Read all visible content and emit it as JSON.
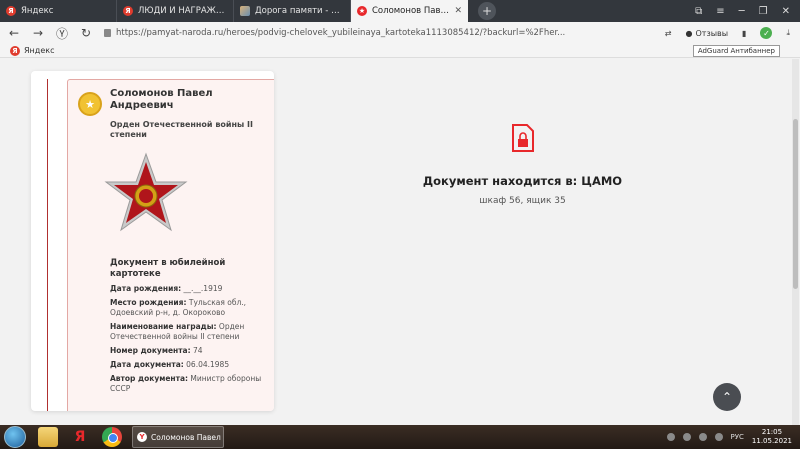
{
  "tabs": [
    {
      "title": "Яндекс",
      "favicon": "yandex-icon",
      "active": false
    },
    {
      "title": "ЛЮДИ И НАГРАЖДЕНИЯ",
      "favicon": "yandex-icon",
      "active": false
    },
    {
      "title": "Дорога памяти - галерея",
      "favicon": "image-icon",
      "active": false
    },
    {
      "title": "Соломонов Павел Андреевич",
      "favicon": "star-icon",
      "active": true
    }
  ],
  "address": {
    "url": "https://pamyat-naroda.ru/heroes/podvig-chelovek_yubileinaya_kartoteka1113085412/?backurl=%2Fher..."
  },
  "toolbar": {
    "reviews_label": "Отзывы",
    "adguard_tooltip": "AdGuard Антибаннер"
  },
  "bookmarks": [
    {
      "label": "Яндекс"
    }
  ],
  "card": {
    "name": "Соломонов Павел Андреевич",
    "award": "Орден Отечественной войны II степени",
    "doc_heading": "Документ в юбилейной картотеке",
    "fields": [
      {
        "label": "Дата рождения:",
        "value": "__.__.1919"
      },
      {
        "label": "Место рождения:",
        "value": "Тульская обл., Одоевский р-н, д. Окороково"
      },
      {
        "label": "Наименование награды:",
        "value": "Орден Отечественной войны II степени"
      },
      {
        "label": "Номер документа:",
        "value": "74"
      },
      {
        "label": "Дата документа:",
        "value": "06.04.1985"
      },
      {
        "label": "Автор документа:",
        "value": "Министр обороны СССР"
      }
    ]
  },
  "document": {
    "title": "Документ находится в: ЦАМО",
    "location": "шкаф 56, ящик 35"
  },
  "taskbar": {
    "task_label": "Соломонов Павел А...",
    "lang": "РУС",
    "time": "21:05",
    "date": "11.05.2021"
  },
  "colors": {
    "accent_red": "#e8282b",
    "dark_tabbar": "#33373d",
    "card_border": "#e3a8a4"
  }
}
